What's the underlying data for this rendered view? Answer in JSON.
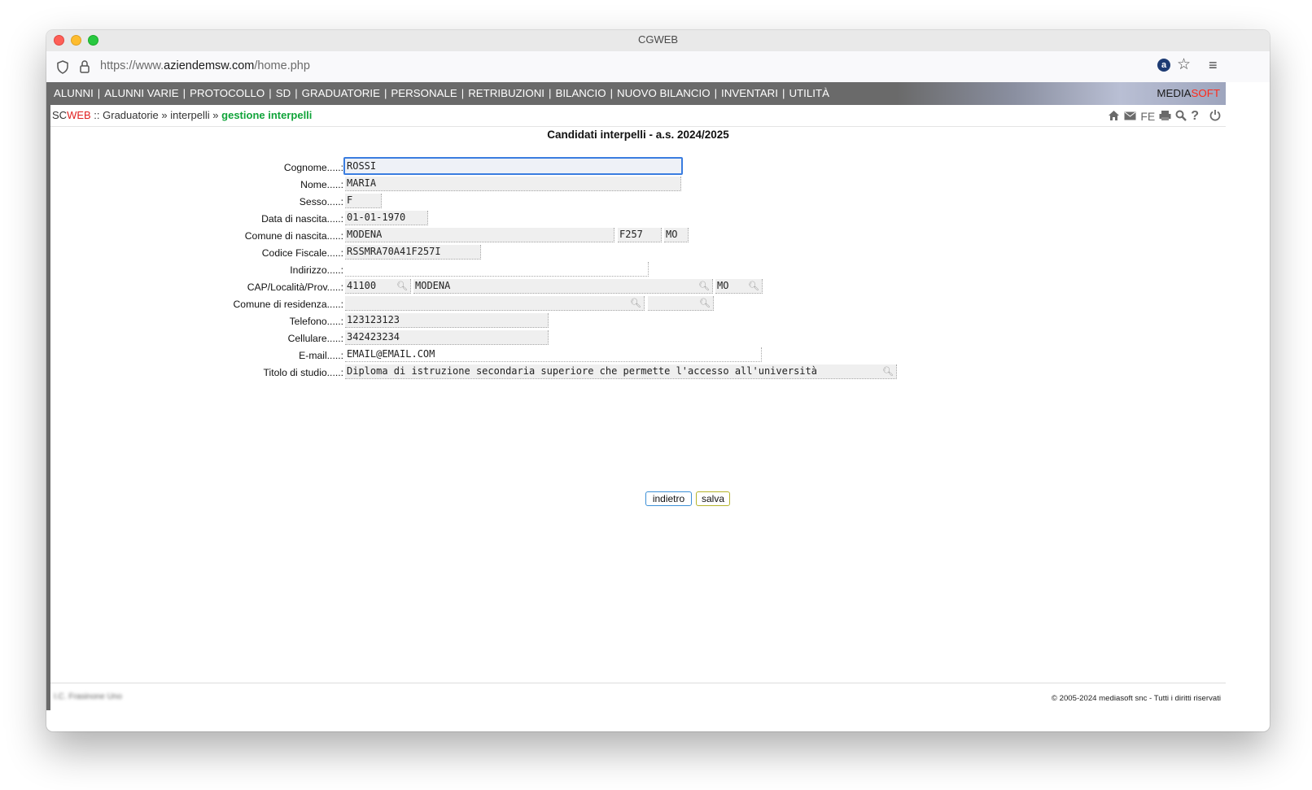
{
  "window": {
    "title": "CGWEB"
  },
  "browser": {
    "url_prefix": "https://www.",
    "url_domain": "aziendemsw.com",
    "url_path": "/home.php",
    "extension_label": "a"
  },
  "topnav": {
    "items": [
      "ALUNNI",
      "ALUNNI VARIE",
      "PROTOCOLLO",
      "SD",
      "GRADUATORIE",
      "PERSONALE",
      "RETRIBUZIONI",
      "BILANCIO",
      "NUOVO BILANCIO",
      "INVENTARI",
      "UTILITÀ"
    ],
    "separator": "|",
    "brand_media": "MEDIA",
    "brand_soft": "SOFT"
  },
  "breadcrumb": {
    "app_sc": "SC",
    "app_web": "WEB",
    "sep1": " :: ",
    "level1": "Graduatorie",
    "sep2": " » ",
    "level2": "interpelli",
    "sep3": " » ",
    "current": "gestione interpelli"
  },
  "toolbar_icons": {
    "fe_label": "FE"
  },
  "form": {
    "title": "Candidati interpelli - a.s. 2024/2025",
    "labels": {
      "cognome": "Cognome.....:",
      "nome": "Nome.....:",
      "sesso": "Sesso.....:",
      "data_nascita": "Data di nascita.....:",
      "comune_nascita": "Comune di nascita.....:",
      "codice_fiscale": "Codice Fiscale.....:",
      "indirizzo": "Indirizzo.....:",
      "cap_localita": "CAP/Località/Prov.....:",
      "comune_residenza": "Comune di residenza.....:",
      "telefono": "Telefono.....:",
      "cellulare": "Cellulare.....:",
      "email": "E-mail.....:",
      "titolo_studio": "Titolo di studio.....:"
    },
    "values": {
      "cognome": "ROSSI",
      "nome": "MARIA",
      "sesso": "F",
      "data_nascita": "01-01-1970",
      "comune_nascita": "MODENA",
      "comune_nascita_codice": "F257",
      "comune_nascita_prov": "MO",
      "codice_fiscale": "RSSMRA70A41F257I",
      "indirizzo": "",
      "cap": "41100",
      "localita": "MODENA",
      "prov": "MO",
      "comune_residenza": "",
      "comune_residenza_prov": "",
      "telefono": "123123123",
      "cellulare": "342423234",
      "email": "EMAIL@EMAIL.COM",
      "titolo_studio": "Diploma di istruzione secondaria superiore che permette l'accesso all'università"
    },
    "buttons": {
      "back": "indietro",
      "save": "salva"
    }
  },
  "footer": {
    "left": "I.C. Frasinone Uno",
    "copyright": "© 2005-2024 mediasoft snc - Tutti i diritti riservati"
  }
}
